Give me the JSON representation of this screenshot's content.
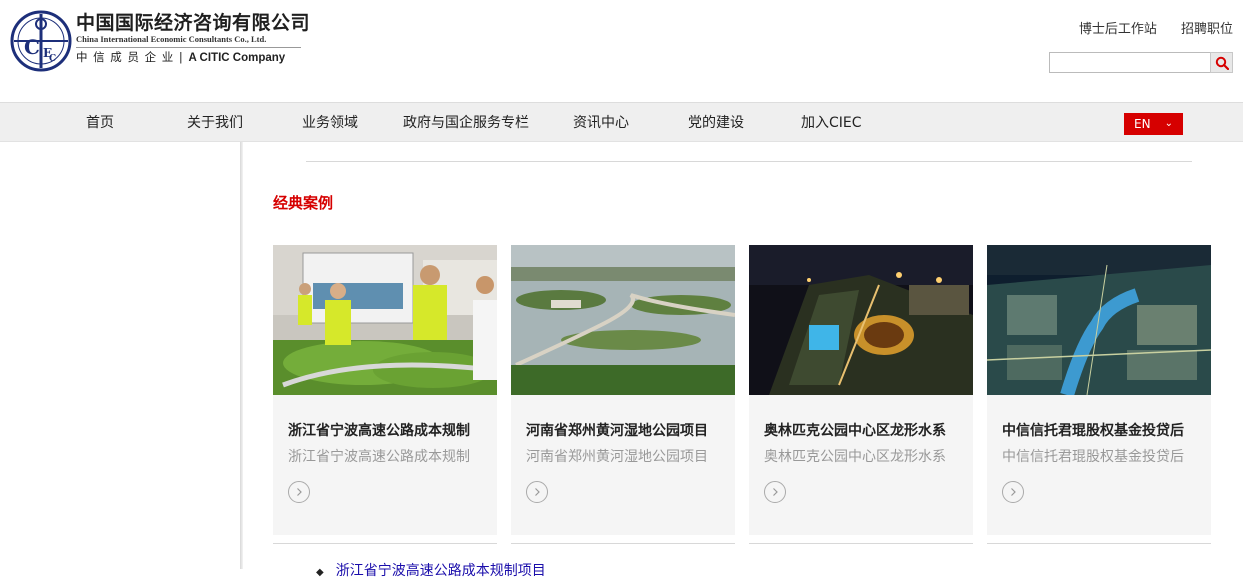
{
  "logo": {
    "name_cn": "中国国际经济咨询有限公司",
    "name_en": "China International Economic Consultants Co., Ltd.",
    "sub_cn": "中 信 成 员 企 业 |",
    "sub_en": "A CITIC Company"
  },
  "top_links": [
    "博士后工作站",
    "招聘职位"
  ],
  "search": {
    "placeholder": "",
    "value": ""
  },
  "nav": [
    "首页",
    "关于我们",
    "业务领域",
    "政府与国企服务专栏",
    "资讯中心",
    "党的建设",
    "加入CIEC"
  ],
  "lang": {
    "label": "EN"
  },
  "section": {
    "title": "经典案例"
  },
  "cards": [
    {
      "title": "浙江省宁波高速公路成本规制",
      "subtitle": "浙江省宁波高速公路成本规制"
    },
    {
      "title": "河南省郑州黄河湿地公园项目",
      "subtitle": "河南省郑州黄河湿地公园项目"
    },
    {
      "title": "奥林匹克公园中心区龙形水系",
      "subtitle": "奥林匹克公园中心区龙形水系"
    },
    {
      "title": "中信信托君琨股权基金投贷后",
      "subtitle": "中信信托君琨股权基金投贷后"
    }
  ],
  "list": [
    {
      "text": "浙江省宁波高速公路成本规制项目"
    }
  ],
  "colors": {
    "accent": "#d60000",
    "nav_bg": "#efefef",
    "card_bg": "#f5f5f5"
  }
}
